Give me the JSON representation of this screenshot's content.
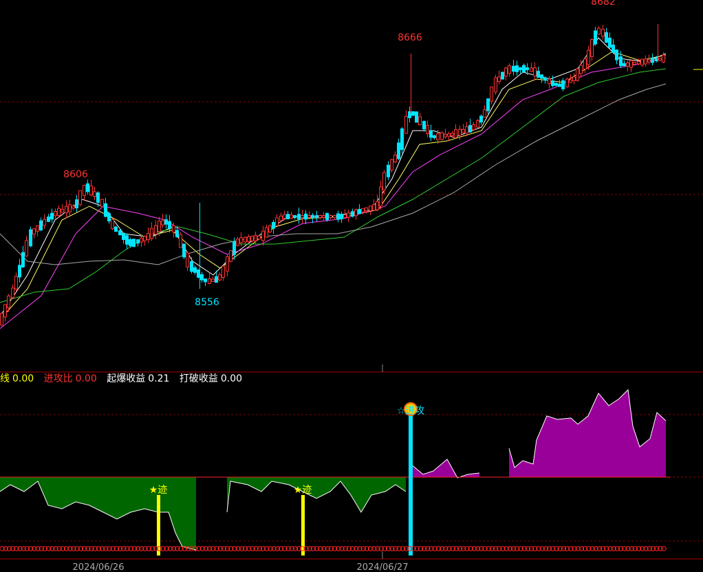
{
  "chart_data": {
    "type": "candlestick",
    "price_labels": {
      "high1": "8606",
      "low1": "8556",
      "high2": "8666",
      "high3": "8682"
    },
    "x_ticks": [
      "2024/06/26",
      "2024/06/27"
    ],
    "indicator_legend": [
      {
        "label": "线",
        "value": "0.00",
        "color": "#ffff00"
      },
      {
        "label": "进攻比",
        "value": "0.00",
        "color": "#ff3333"
      },
      {
        "label": "起爆收益",
        "value": "0.21",
        "color": "#ffffff"
      },
      {
        "label": "打破收益",
        "value": "0.00",
        "color": "#ffffff"
      }
    ],
    "signals": [
      {
        "text": "★迹",
        "color": "#ffff00"
      },
      {
        "text": "★迹",
        "color": "#ffff00"
      },
      {
        "text": "☆进攻",
        "color": "#00e5ff"
      }
    ],
    "series_colors": {
      "up": "#ff3333",
      "down": "#00e5ff",
      "ma5": "#ffffff",
      "ma10": "#ffff66",
      "ma20": "#ff44ff",
      "ma30": "#33cc33",
      "ma60": "#aaaaaa",
      "positive_area": "#990099",
      "negative_area": "#006600"
    }
  }
}
